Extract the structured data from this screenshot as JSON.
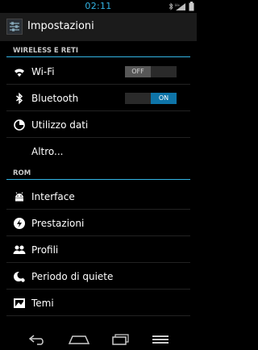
{
  "status": {
    "time": "02:11"
  },
  "actionbar": {
    "title": "Impostazioni"
  },
  "sections": [
    {
      "header": "WIRELESS E RETI",
      "items": [
        {
          "label": "Wi-Fi",
          "icon": "wifi-icon",
          "toggle": {
            "off": "OFF",
            "on": "ON",
            "state": "off"
          }
        },
        {
          "label": "Bluetooth",
          "icon": "bluetooth-icon",
          "toggle": {
            "off": "",
            "on": "ON",
            "state": "on"
          }
        },
        {
          "label": "Utilizzo dati",
          "icon": "data-usage-icon"
        },
        {
          "label": "Altro...",
          "icon": ""
        }
      ]
    },
    {
      "header": "ROM",
      "items": [
        {
          "label": "Interface",
          "icon": "android-icon"
        },
        {
          "label": "Prestazioni",
          "icon": "lightning-icon"
        },
        {
          "label": "Profili",
          "icon": "people-icon"
        },
        {
          "label": "Periodo di quiete",
          "icon": "moon-icon"
        },
        {
          "label": "Temi",
          "icon": "theme-icon"
        }
      ]
    }
  ],
  "colors": {
    "accent": "#33b5e5",
    "toggle_on": "#0e74a8",
    "background": "#000000",
    "actionbar": "#1b1b1b"
  },
  "navbar": {
    "buttons": [
      "back-icon",
      "home-icon",
      "recent-apps-icon",
      "menu-icon"
    ]
  }
}
